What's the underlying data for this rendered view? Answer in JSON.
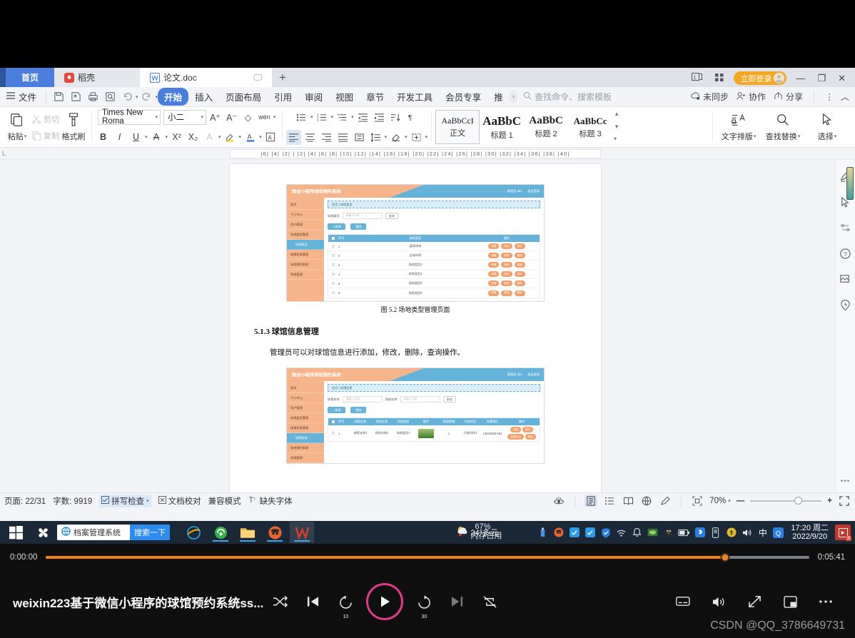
{
  "app": {
    "tabs": [
      {
        "label": "首页",
        "icon": "home-icon",
        "type": "home"
      },
      {
        "label": "稻壳",
        "icon": "daoke-icon",
        "type": "mid"
      },
      {
        "label": "论文.doc",
        "icon": "wps-doc-icon",
        "type": "doc"
      }
    ],
    "new_tab": "+",
    "window": {
      "login_label": "立即登录",
      "minimize": "—",
      "maximize": "❐",
      "close": "✕"
    }
  },
  "ribbon_menu": {
    "file_label": "文件",
    "tabs": [
      {
        "label": "开始",
        "active": true
      },
      {
        "label": "插入",
        "active": false
      },
      {
        "label": "页面布局",
        "active": false
      },
      {
        "label": "引用",
        "active": false
      },
      {
        "label": "审阅",
        "active": false
      },
      {
        "label": "视图",
        "active": false
      },
      {
        "label": "章节",
        "active": false
      },
      {
        "label": "开发工具",
        "active": false
      },
      {
        "label": "会员专享",
        "active": false
      },
      {
        "label": "推",
        "active": false
      }
    ],
    "more_caret": "›",
    "search_placeholder": "查找命令、搜索模板",
    "right": [
      {
        "label": "未同步",
        "icon": "cloud-sync-icon"
      },
      {
        "label": "协作",
        "icon": "collaborate-icon"
      },
      {
        "label": "分享",
        "icon": "share-icon"
      }
    ],
    "overflow": "⋮",
    "collapse": "︿"
  },
  "ribbon": {
    "clipboard": {
      "paste": "粘贴",
      "cut": "剪切",
      "copy": "复制",
      "format_painter": "格式刷"
    },
    "font": {
      "name": "Times New Roma",
      "size": "小二",
      "grow": "A⁺",
      "shrink": "A⁻",
      "clear_format": "◇",
      "pinyin": "wén",
      "bold": "B",
      "italic": "I",
      "underline": "U",
      "strike": "A",
      "superscript": "X²",
      "subscript": "X₂",
      "char_border": "A",
      "highlight": "✎",
      "font_color": "A",
      "char_shading": "A"
    },
    "paragraph": {
      "align_left": "≡",
      "align_center": "≡",
      "align_right": "≡",
      "justify": "≡",
      "distribute": "≡",
      "line_spacing": "⇕",
      "shading": "▨",
      "borders": "⊞",
      "bullets": "•≡",
      "numbering": "1≡",
      "multilevel": "≡",
      "decrease_indent": "⇤",
      "increase_indent": "⇥"
    },
    "styles": [
      {
        "preview": "AaBbCcI",
        "name": "正文",
        "selected": true,
        "size": "12px"
      },
      {
        "preview": "AaBbC",
        "name": "标题 1",
        "selected": false,
        "size": "17px"
      },
      {
        "preview": "AaBbC",
        "name": "标题 2",
        "selected": false,
        "size": "15px"
      },
      {
        "preview": "AaBbCc",
        "name": "标题 3",
        "selected": false,
        "size": "13px"
      }
    ],
    "style_scroll": {
      "up": "▲",
      "down": "▼",
      "expand": "▾"
    },
    "right_tools": [
      {
        "label": "文字排版",
        "icon": "text-layout-icon"
      },
      {
        "label": "查找替换",
        "icon": "search-replace-icon"
      },
      {
        "label": "选择",
        "icon": "select-cursor-icon"
      }
    ]
  },
  "ruler": {
    "marks": "|6|  |4|  |2|  |    |2|  |4|  |6|  |8|  |10|  |12|  |14|  |16|  |18|  |20|  |22|  |24|  |26|  |28|  |30|  |32|  |34|  |36|  |38|  |40|",
    "corner": "L"
  },
  "document": {
    "figure_caption_1": "图 5.2 场地类型管理页面",
    "heading": "5.1.3  球馆信息管理",
    "paragraph": "管理员可以对球馆信息进行添加，修改，删除，查询操作。",
    "screenshot_1": {
      "app_title": "微信小程序球馆预约系统",
      "user_label": "管理员 abc",
      "logout_label": "退出登录",
      "breadcrumb": "首页 | 场地类型",
      "sidebar": [
        {
          "label": "首页",
          "active": false
        },
        {
          "label": "个人中心",
          "active": false
        },
        {
          "label": "用户管理",
          "active": false
        },
        {
          "label": "场地类型管理",
          "active": false
        },
        {
          "label": "场地类型",
          "active": true
        },
        {
          "label": "球馆信息管理",
          "active": false
        },
        {
          "label": "场地预约管理",
          "active": false
        },
        {
          "label": "系统管理",
          "active": false
        }
      ],
      "search_label": "场地类型",
      "search_placeholder": "请输入内容",
      "search_button": "查询",
      "add_button": "+ 新增",
      "delete_button": "删除",
      "columns": [
        "序号",
        "场地类型",
        "操作"
      ],
      "rows": [
        {
          "no": "1",
          "name": "篮球场地",
          "actions": [
            "详情",
            "修改",
            "删除"
          ]
        },
        {
          "no": "2",
          "name": "足球场地",
          "actions": [
            "详情",
            "修改",
            "删除"
          ]
        },
        {
          "no": "3",
          "name": "场地类型3",
          "actions": [
            "详情",
            "修改",
            "删除"
          ]
        },
        {
          "no": "4",
          "name": "场地类型4",
          "actions": [
            "详情",
            "修改",
            "删除"
          ]
        },
        {
          "no": "5",
          "name": "场地类型5",
          "actions": [
            "详情",
            "修改",
            "删除"
          ]
        },
        {
          "no": "6",
          "name": "场地类型6",
          "actions": [
            "详情",
            "修改",
            "删除"
          ]
        }
      ]
    },
    "screenshot_2": {
      "app_title": "微信小程序球馆预约系统",
      "user_label": "管理员 abc",
      "logout_label": "退出登录",
      "breadcrumb": "首页 | 球馆信息",
      "sidebar": [
        {
          "label": "首页",
          "active": false
        },
        {
          "label": "个人中心",
          "active": false
        },
        {
          "label": "用户管理",
          "active": false
        },
        {
          "label": "场地类型管理",
          "active": false
        },
        {
          "label": "球馆信息管理",
          "active": false
        },
        {
          "label": "球馆信息",
          "active": true
        },
        {
          "label": "场地预约管理",
          "active": false
        },
        {
          "label": "系统管理",
          "active": false
        }
      ],
      "search_label_1": "球馆名称",
      "search_label_2": "场地名称",
      "search_placeholder": "请输入内容",
      "search_button": "查询",
      "add_button": "+ 新增",
      "delete_button": "删除",
      "columns": [
        "序号",
        "球馆名称",
        "场地名称",
        "场地类型",
        "图片",
        "场地数量",
        "开放时间",
        "所属地区",
        "操作"
      ],
      "row": {
        "no": "1",
        "venue": "球馆名称1",
        "field": "场地名称1",
        "type": "场地类型1",
        "count": "1",
        "open_time": "开放时间1",
        "area": "13623666 881",
        "actions": [
          "详情",
          "修改",
          "查看评论",
          "删除"
        ]
      }
    }
  },
  "right_rail": {
    "buttons": [
      {
        "icon": "pen-highlight-icon"
      },
      {
        "icon": "cursor-select-icon"
      },
      {
        "icon": "settings-sliders-icon"
      },
      {
        "icon": "help-question-icon"
      },
      {
        "icon": "image-tool-icon"
      },
      {
        "icon": "feedback-badge-icon"
      }
    ],
    "more": "•••"
  },
  "status_bar": {
    "page": "页面: 22/31",
    "words": "字数: 9919",
    "spell_check": "拼写检查",
    "proofread": "文档校对",
    "compat_mode": "兼容模式",
    "missing_font": "缺失字体",
    "zoom_level": "70%",
    "zoom_minus": "—",
    "zoom_plus": "+",
    "view_modes": [
      {
        "icon": "eye-reading-icon",
        "selected": false
      },
      {
        "icon": "page-layout-icon",
        "selected": true
      },
      {
        "icon": "outline-icon",
        "selected": false
      },
      {
        "icon": "book-read-icon",
        "selected": false
      },
      {
        "icon": "web-layout-icon",
        "selected": false
      },
      {
        "icon": "pen-markup-icon",
        "selected": false
      }
    ],
    "fit_page_icon": "fit-page-icon",
    "fullscreen_icon": "fullscreen-icon"
  },
  "taskbar": {
    "start_icon": "windows-start-icon",
    "search_value": "档案管理系统",
    "search_button": "搜索一下",
    "apps": [
      {
        "icon": "ie-browser-icon",
        "active": false
      },
      {
        "icon": "360-browser-icon",
        "active": false
      },
      {
        "icon": "file-explorer-icon",
        "active": false
      },
      {
        "icon": "navicat-icon",
        "active": false
      },
      {
        "icon": "wps-writer-icon",
        "active": true
      }
    ],
    "weather_temp": "24°多云",
    "memory": "67%",
    "memory_label": "内存占用",
    "tray_icons": [
      "usb-icon",
      "navicat-tray-icon",
      "wechat-dev-icon",
      "wechat-dev2-icon",
      "tencent-shield-icon",
      "wifi-icon",
      "bell-icon",
      "green-badge-icon",
      "qq-penguin-icon",
      "battery-icon",
      "bluetooth-icon",
      "dock-icon",
      "update-icon",
      "volume-icon"
    ],
    "ime_label": "中",
    "qq_label": "Q",
    "time": "17:20 周二",
    "date": "2022/9/20",
    "notification_badge": "8"
  },
  "player": {
    "current_time": "0:00:00",
    "duration": "0:05:41",
    "progress_percent": 89,
    "title": "weixin223基于微信小程序的球馆预约系统ss...",
    "controls": {
      "shuffle": "shuffle-icon",
      "previous": "previous-track-icon",
      "rewind_10": "rewind-10-icon",
      "rewind_label": "10",
      "play": "play-icon",
      "forward_30": "forward-30-icon",
      "forward_label": "30",
      "next": "next-track-icon",
      "repeat_off": "repeat-off-icon",
      "subtitles": "subtitles-icon",
      "volume": "volume-icon",
      "expand": "expand-icon",
      "mini_player": "mini-player-icon",
      "more": "more-options-icon"
    },
    "watermark": "CSDN @QQ_3786649731"
  },
  "colors": {
    "accent_blue": "#4a7ddc",
    "login_orange": "#f5a623",
    "progress_orange": "#f08219",
    "taskbar_dark": "#1b2838",
    "shot_orange": "#f6b48a",
    "shot_blue": "#66b3d9"
  }
}
